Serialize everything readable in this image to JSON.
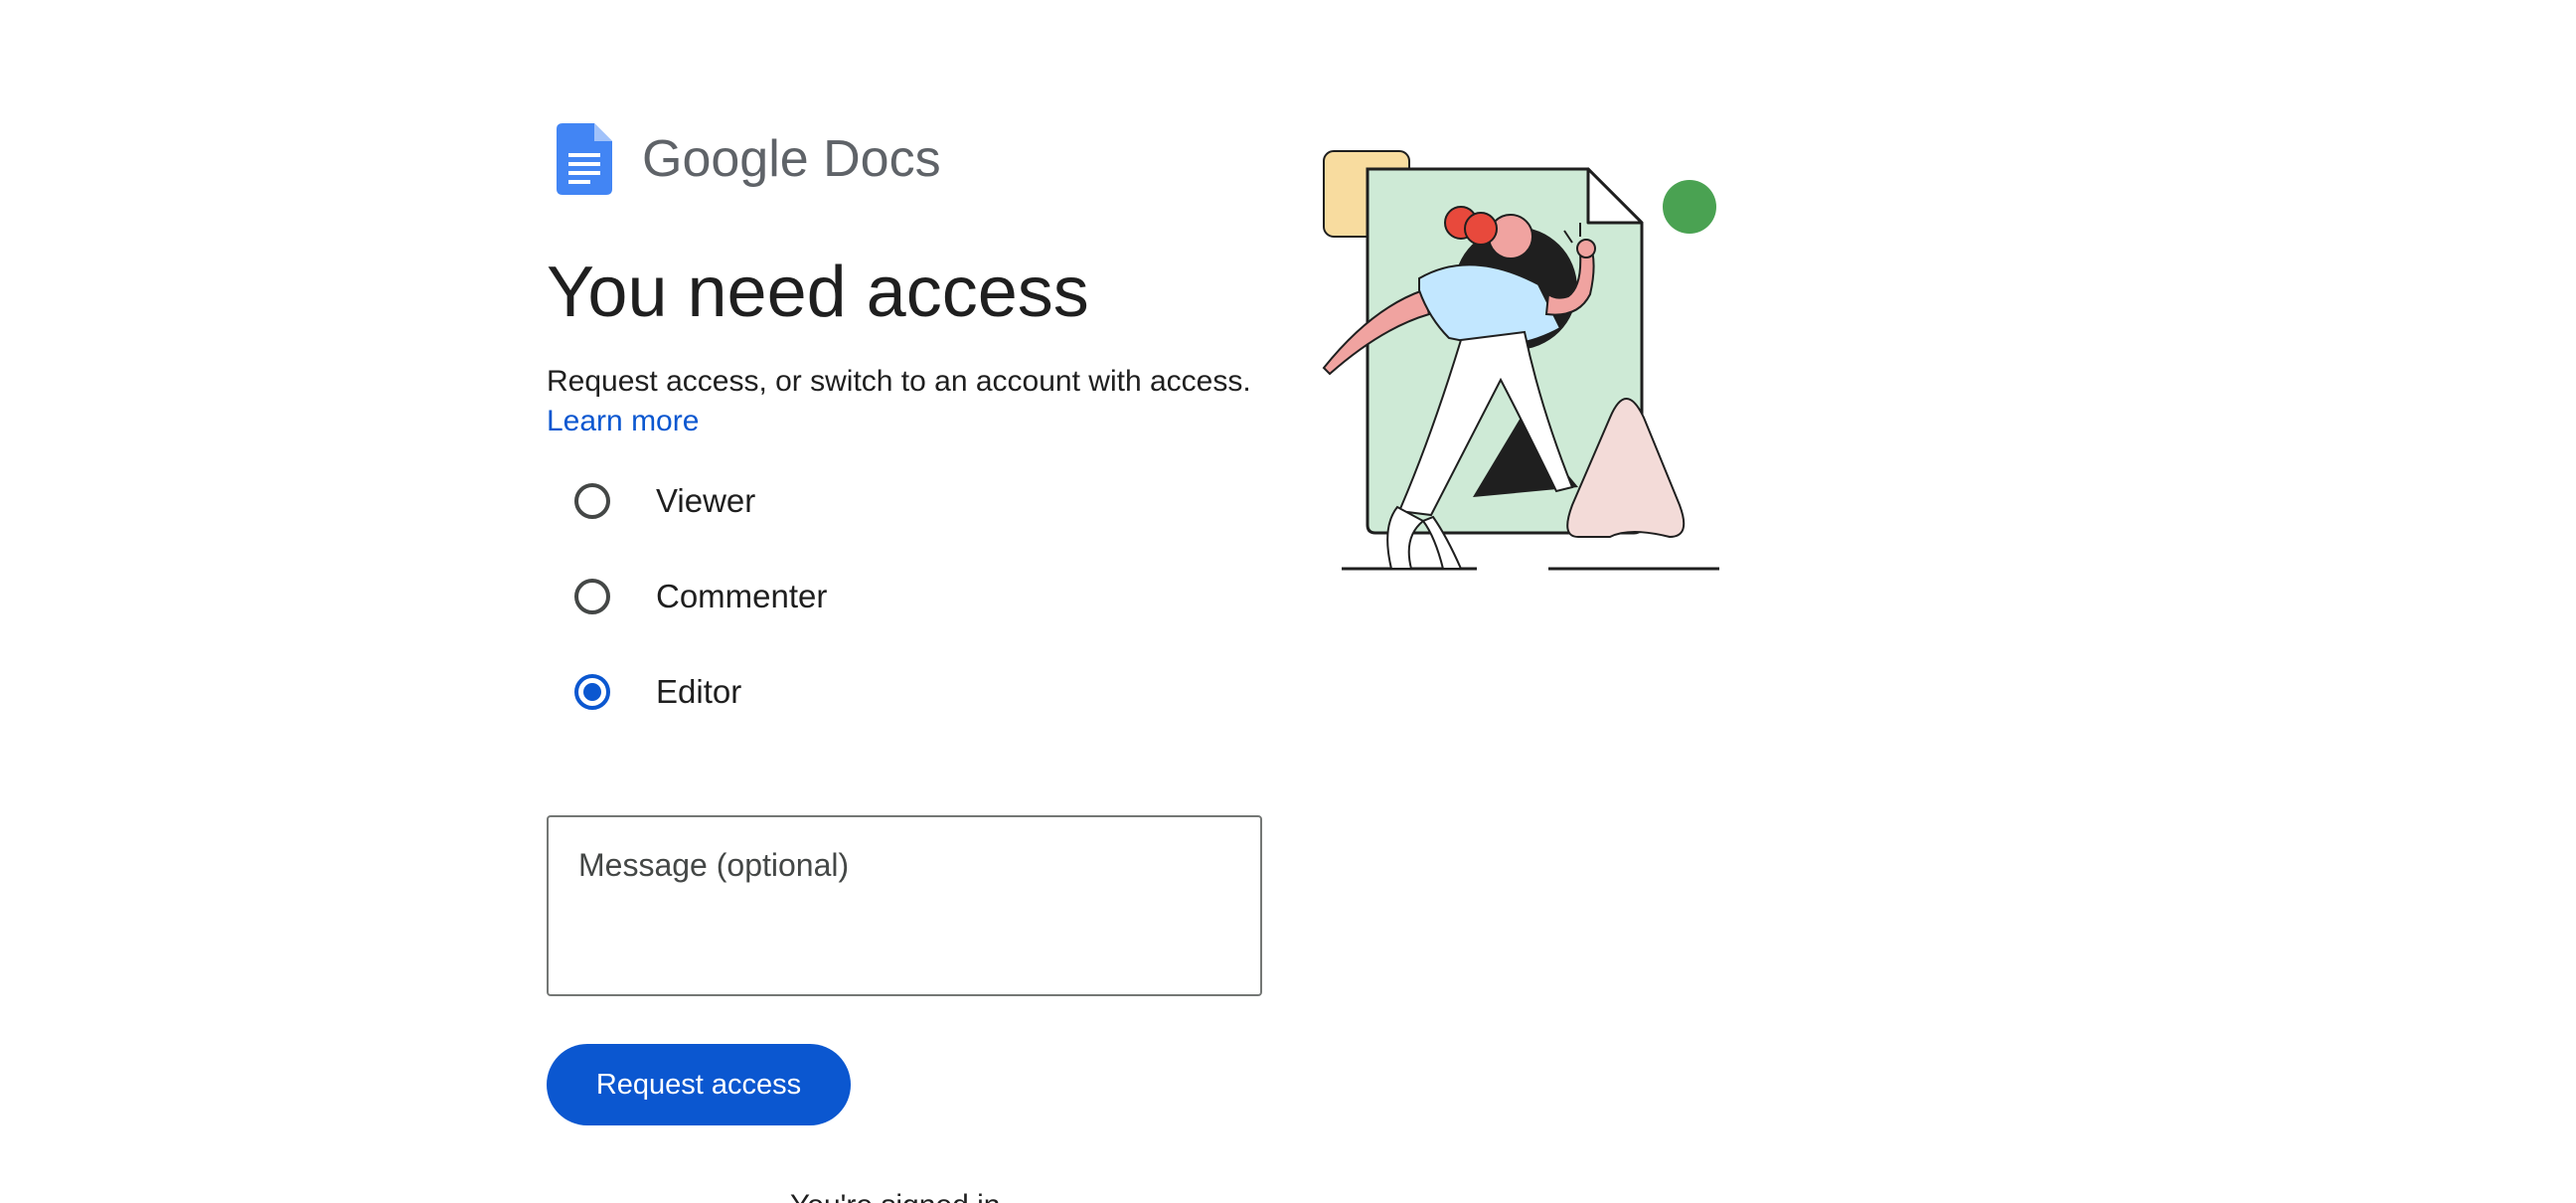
{
  "brand": {
    "name": "Google Docs"
  },
  "page": {
    "title": "You need access",
    "subtitle": "Request access, or switch to an account with access.",
    "learn_more": "Learn more"
  },
  "access_options": [
    {
      "label": "Viewer",
      "checked": false
    },
    {
      "label": "Commenter",
      "checked": false
    },
    {
      "label": "Editor",
      "checked": true
    }
  ],
  "message": {
    "placeholder": "Message (optional)",
    "value": ""
  },
  "actions": {
    "request_label": "Request access"
  },
  "footer": {
    "partial_text": "You're signed in"
  },
  "colors": {
    "accent": "#0b57d0",
    "docs_blue": "#4285f4",
    "text": "#1f1f1f"
  }
}
